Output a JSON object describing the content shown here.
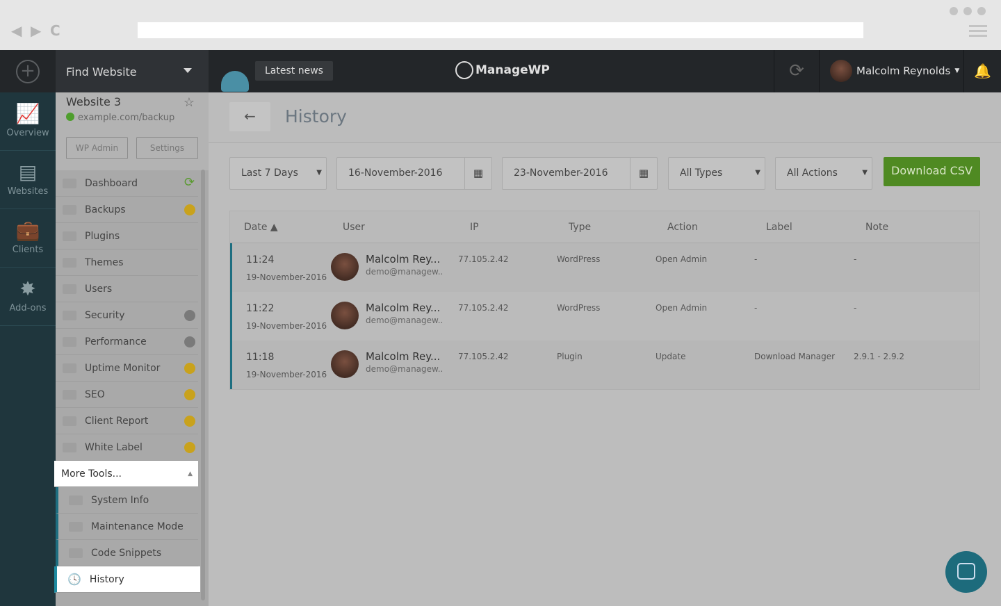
{
  "browser": {
    "back": "◀",
    "forward": "▶",
    "reload": "C"
  },
  "topbar": {
    "find_website": "Find Website",
    "latest_news": "Latest news",
    "logo": "ManageWP",
    "user": "Malcolm Reynolds"
  },
  "leftnav": [
    {
      "label": "Overview",
      "icon": "📈"
    },
    {
      "label": "Websites",
      "icon": "▤"
    },
    {
      "label": "Clients",
      "icon": "💼"
    },
    {
      "label": "Add-ons",
      "icon": "✸"
    }
  ],
  "site": {
    "name": "Website 3",
    "url": "example.com/backup",
    "wp_admin": "WP Admin",
    "settings": "Settings"
  },
  "tools": [
    {
      "label": "Dashboard",
      "badge": "sync"
    },
    {
      "label": "Backups",
      "badge": "premium"
    },
    {
      "label": "Plugins"
    },
    {
      "label": "Themes"
    },
    {
      "label": "Users"
    },
    {
      "label": "Security",
      "badge": "gear"
    },
    {
      "label": "Performance",
      "badge": "gear"
    },
    {
      "label": "Uptime Monitor",
      "badge": "premium"
    },
    {
      "label": "SEO",
      "badge": "premium"
    },
    {
      "label": "Client Report",
      "badge": "premium"
    },
    {
      "label": "White Label",
      "badge": "premium"
    }
  ],
  "more_tools": "More Tools...",
  "sub_tools": [
    "System Info",
    "Maintenance Mode",
    "Code Snippets"
  ],
  "active_tool": "History",
  "page": {
    "title": "History",
    "filters": {
      "range": "Last 7 Days",
      "from": "16-November-2016",
      "to": "23-November-2016",
      "types": "All Types",
      "actions": "All Actions"
    },
    "download_csv": "Download CSV"
  },
  "table": {
    "headers": [
      "Date ▲",
      "User",
      "IP",
      "Type",
      "Action",
      "Label",
      "Note"
    ],
    "rows": [
      {
        "time": "11:24",
        "date": "19-November-2016",
        "name": "Malcolm Rey...",
        "email": "demo@managew..",
        "ip": "77.105.2.42",
        "type": "WordPress",
        "action": "Open Admin",
        "label": "-",
        "note": "-"
      },
      {
        "time": "11:22",
        "date": "19-November-2016",
        "name": "Malcolm Rey...",
        "email": "demo@managew..",
        "ip": "77.105.2.42",
        "type": "WordPress",
        "action": "Open Admin",
        "label": "-",
        "note": "-"
      },
      {
        "time": "11:18",
        "date": "19-November-2016",
        "name": "Malcolm Rey...",
        "email": "demo@managew..",
        "ip": "77.105.2.42",
        "type": "Plugin",
        "action": "Update",
        "label": "Download Manager",
        "note": "2.9.1 - 2.9.2"
      }
    ]
  },
  "colors": {
    "accent": "#1e8aa0",
    "csv_button": "#6ab42d",
    "premium": "#f2c21a"
  }
}
